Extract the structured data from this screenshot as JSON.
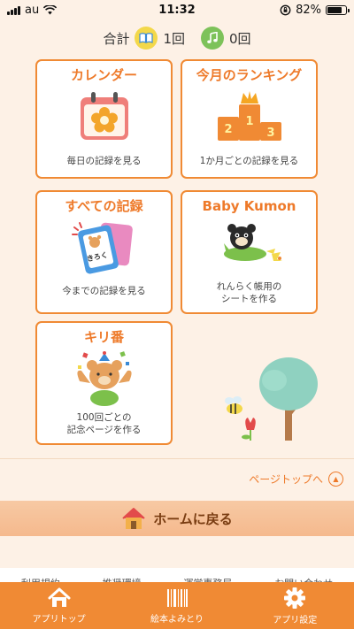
{
  "status_bar": {
    "carrier": "au",
    "time": "11:32",
    "battery": "82%"
  },
  "totals": {
    "label": "合計",
    "books_count": "1回",
    "songs_count": "0回"
  },
  "cards": {
    "calendar": {
      "title": "カレンダー",
      "desc": "毎日の記録を見る"
    },
    "ranking": {
      "title": "今月のランキング",
      "desc": "1か月ごとの記録を見る"
    },
    "all_records": {
      "title": "すべての記録",
      "desc": "今までの記録を見る",
      "icon_text": "きろく"
    },
    "baby_kumon": {
      "title": "Baby Kumon",
      "desc_line1": "れんらく帳用の",
      "desc_line2": "シートを作る"
    },
    "kiriban": {
      "title": "キリ番",
      "desc_line1": "100回ごとの",
      "desc_line2": "記念ページを作る"
    }
  },
  "page_top": "ページトップへ",
  "home_button": "ホームに戻る",
  "footer_links": [
    "利用規約",
    "推奨環境",
    "運営事務局",
    "お問い合わせ"
  ],
  "tabs": [
    {
      "label": "アプリトップ",
      "icon": "home-icon"
    },
    {
      "label": "絵本よみとり",
      "icon": "barcode-icon"
    },
    {
      "label": "アプリ設定",
      "icon": "gear-icon"
    }
  ],
  "colors": {
    "accent": "#f08a34",
    "background": "#fdf1e6",
    "title": "#ee7a2a"
  }
}
